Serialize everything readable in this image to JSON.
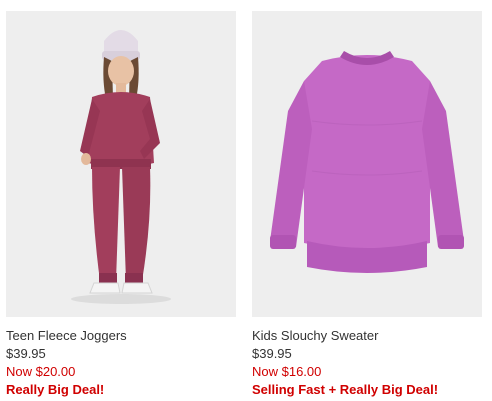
{
  "colors": {
    "image_bg": "#eeeeee",
    "sale_red": "#d00000",
    "text_gray": "#333333",
    "joggers": "#a23e5c",
    "sweater": "#c569c6"
  },
  "products": [
    {
      "name": "Teen Fleece Joggers",
      "original_price": "$39.95",
      "sale_price": "Now $20.00",
      "promo": "Really Big Deal!",
      "image_icon": "product-photo-joggers"
    },
    {
      "name": "Kids Slouchy Sweater",
      "original_price": "$39.95",
      "sale_price": "Now $16.00",
      "promo": "Selling Fast + Really Big Deal!",
      "image_icon": "product-photo-sweater"
    }
  ]
}
